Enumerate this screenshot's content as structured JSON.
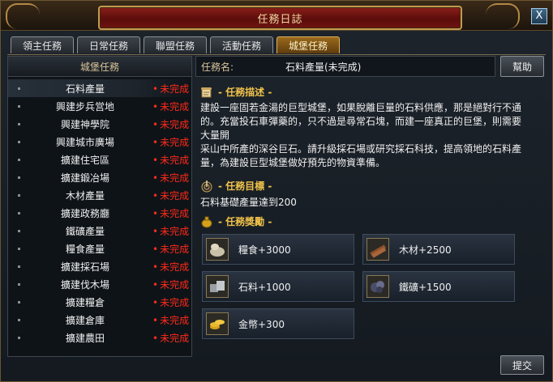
{
  "window": {
    "title": "任務日誌",
    "close_label": "X"
  },
  "tabs": [
    {
      "label": "領主任務",
      "active": false
    },
    {
      "label": "日常任務",
      "active": false
    },
    {
      "label": "聯盟任務",
      "active": false
    },
    {
      "label": "活動任務",
      "active": false
    },
    {
      "label": "城堡任務",
      "active": true
    }
  ],
  "quest_list": {
    "header": "城堡任務",
    "items": [
      {
        "name": "石料產量",
        "status": "未完成"
      },
      {
        "name": "興建步兵営地",
        "status": "未完成"
      },
      {
        "name": "興建神學院",
        "status": "未完成"
      },
      {
        "name": "興建城市廣場",
        "status": "未完成"
      },
      {
        "name": "擴建住宅區",
        "status": "未完成"
      },
      {
        "name": "擴建鍛冶場",
        "status": "未完成"
      },
      {
        "name": "木材產量",
        "status": "未完成"
      },
      {
        "name": "擴建政務廳",
        "status": "未完成"
      },
      {
        "name": "鐵礦產量",
        "status": "未完成"
      },
      {
        "name": "糧食產量",
        "status": "未完成"
      },
      {
        "name": "擴建採石場",
        "status": "未完成"
      },
      {
        "name": "擴建伐木場",
        "status": "未完成"
      },
      {
        "name": "擴建糧倉",
        "status": "未完成"
      },
      {
        "name": "擴建倉庫",
        "status": "未完成"
      },
      {
        "name": "擴建農田",
        "status": "未完成"
      }
    ]
  },
  "detail": {
    "name_label": "任務名:",
    "name_value": "石料產量(未完成)",
    "help_label": "幫助",
    "description_title": "- 任務描述 -",
    "description_lines": [
      "建設一座固若金湯的巨型城堡，如果脫離巨量的石料供應，那是絕對行不通",
      "的。充當投石車彈藥的，只不過是尋常石塊，而建一座真正的巨堡，則需要",
      "大量開",
      "采山中所產的深谷巨石。請升級採石場或研究採石科技，提高領地的石料產",
      "量，為建設巨型城堡做好預先的物資準備。"
    ],
    "objective_title": "- 任務目標 -",
    "objective_text": "石料基礎產量達到200",
    "reward_title": "- 任務獎勵 -",
    "rewards": [
      {
        "label": "糧食+3000",
        "icon": "grain-icon",
        "color": "#c9c1a8"
      },
      {
        "label": "木材+2500",
        "icon": "wood-icon",
        "color": "#8a4f2a"
      },
      {
        "label": "石料+1000",
        "icon": "stone-icon",
        "color": "#9aa0a6"
      },
      {
        "label": "鐵礦+1500",
        "icon": "iron-ore-icon",
        "color": "#4a4d6a"
      },
      {
        "label": "金幣+300",
        "icon": "gold-coins-icon",
        "color": "#d4a21a"
      }
    ]
  },
  "submit_label": "提交"
}
